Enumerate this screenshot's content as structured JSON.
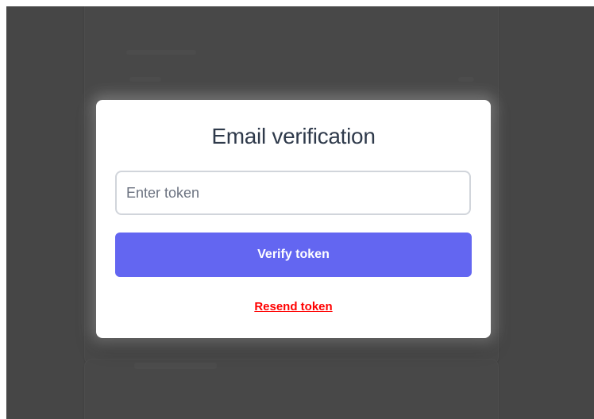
{
  "modal": {
    "title": "Email verification",
    "token_input": {
      "placeholder": "Enter token",
      "value": ""
    },
    "verify_button_label": "Verify token",
    "resend_link_label": "Resend token"
  },
  "colors": {
    "backdrop": "#525252",
    "primary_button": "#6366f1",
    "resend_link": "#ff0000",
    "title_text": "#2f3a4b"
  }
}
